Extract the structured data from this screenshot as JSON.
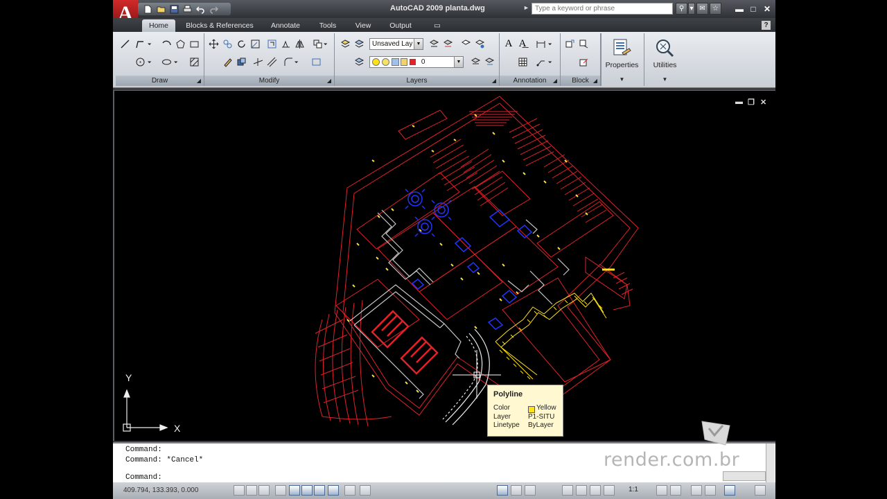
{
  "window": {
    "title": "AutoCAD 2009  planta.dwg"
  },
  "search": {
    "placeholder": "Type a keyword or phrase"
  },
  "tabs": [
    {
      "label": "Home"
    },
    {
      "label": "Blocks & References"
    },
    {
      "label": "Annotate"
    },
    {
      "label": "Tools"
    },
    {
      "label": "View"
    },
    {
      "label": "Output"
    }
  ],
  "ribbon": {
    "panels": {
      "draw": "Draw",
      "modify": "Modify",
      "layers": "Layers",
      "annotation": "Annotation",
      "block": "Block"
    },
    "layer_state_value": "Unsaved Lay",
    "current_layer_value": "0",
    "properties_label": "Properties",
    "utilities_label": "Utilities"
  },
  "tooltip": {
    "title": "Polyline",
    "color_key": "Color",
    "color_value": "Yellow",
    "layer_key": "Layer",
    "layer_value": "P1-SITU",
    "linetype_key": "Linetype",
    "linetype_value": "ByLayer"
  },
  "ucs": {
    "x_label": "X",
    "y_label": "Y"
  },
  "command": {
    "line1": "Command:",
    "line2": "Command: *Cancel*",
    "prompt": "Command:"
  },
  "watermark": "render.com.br",
  "status": {
    "coordinates": "409.794, 133.393, 0.000",
    "scale": "1:1"
  },
  "colors": {
    "drawing_bg": "#000000",
    "red": "#e0222a",
    "blue": "#2233ff",
    "yellow": "#ffe21a",
    "white": "#ffffff"
  }
}
